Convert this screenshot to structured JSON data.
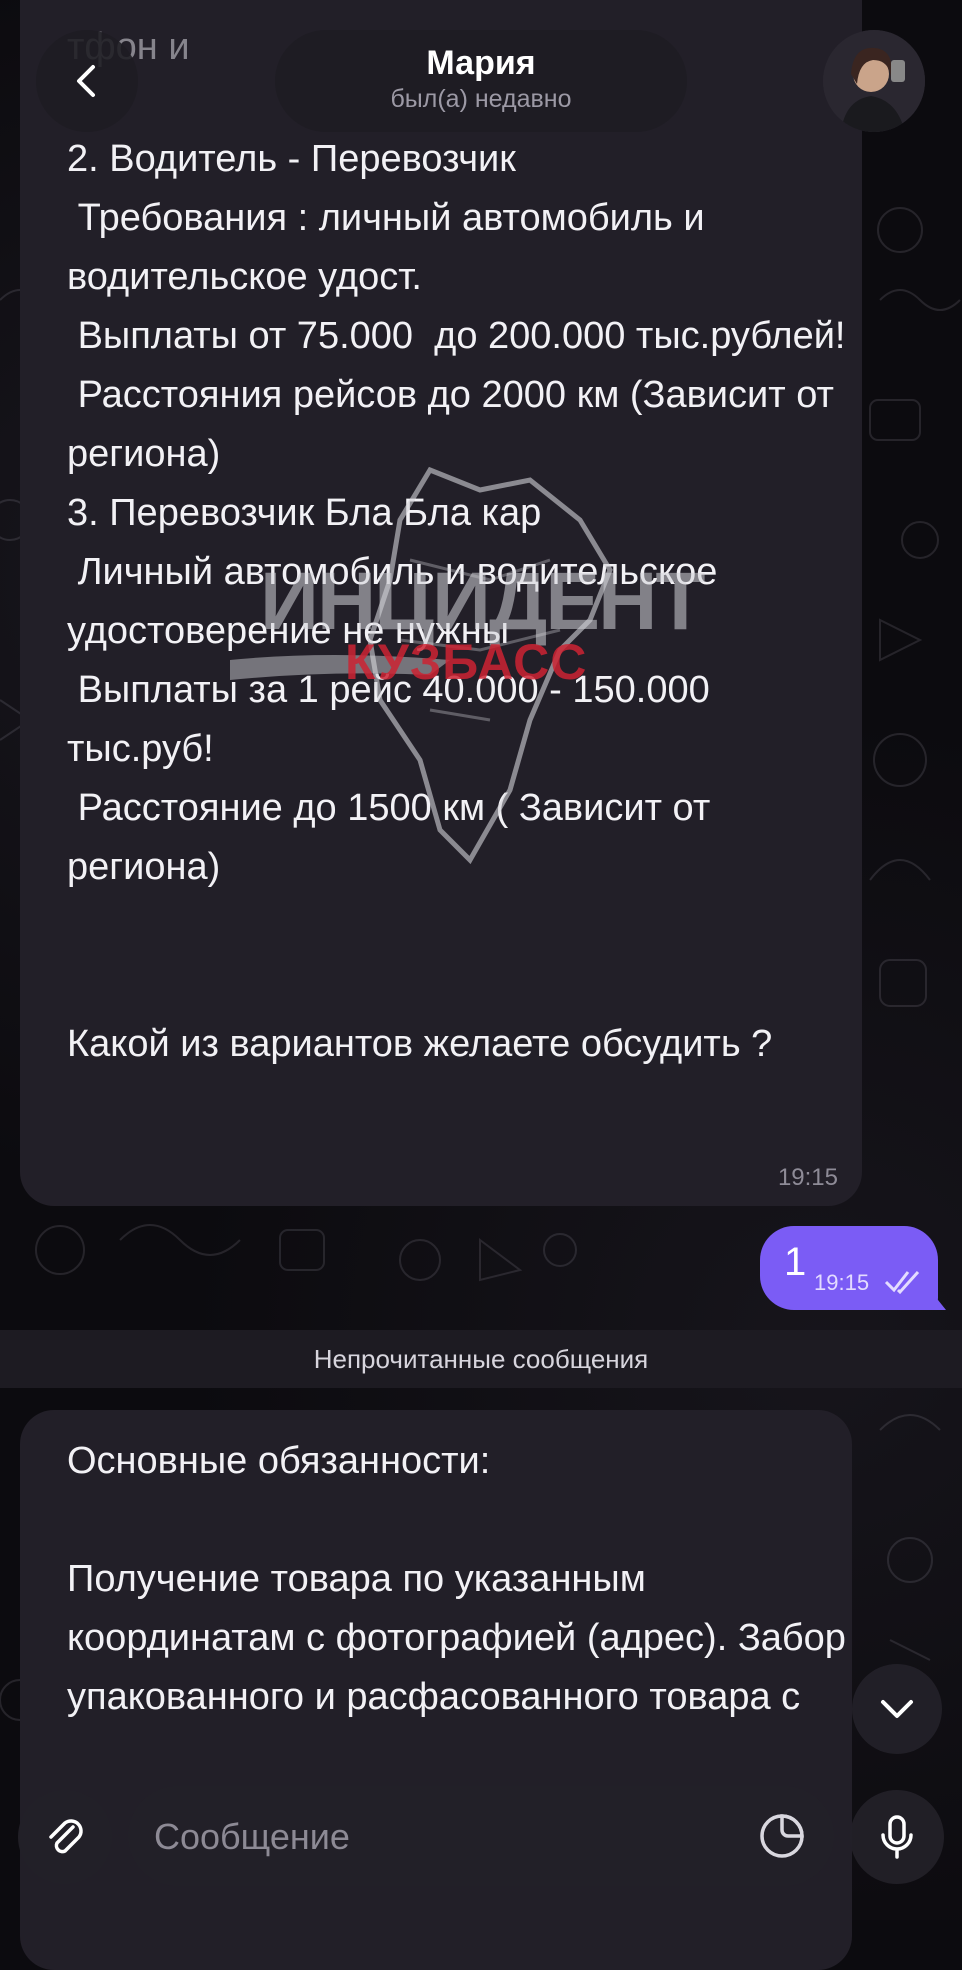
{
  "header": {
    "contact_name": "Мария",
    "status": "был(а) недавно"
  },
  "messages": {
    "first": {
      "partial_top": "тфон и",
      "text": "2. Водитель - Перевозчик\n Требования : личный автомобиль и водительское удост.\n Выплаты от 75.000  до 200.000 тыс.рублей!\n Расстояния рейсов до 2000 км (Зависит от региона)\n3. Перевозчик Бла Бла кар\n Личный автомобиль и водительское удостоверение не нужны\n Выплаты за 1 рейс 40.000 - 150.000 тыс.руб!\n Расстояние до 1500 км ( Зависит от региона)\n\n\nКакой из вариантов желаете обсудить ?",
      "time": "19:15"
    },
    "outgoing": {
      "text": "1",
      "time": "19:15"
    },
    "second": {
      "text": "Основные обязанности:\n\nПолучение товара по указанным координатам с фотографией (адрес). Забор упакованного и расфасованного товара с"
    }
  },
  "unread_label": "Непрочитанные сообщения",
  "watermark": {
    "line1": "ИНЦИДЕНТ",
    "line2": "КУЗБАСС"
  },
  "input": {
    "placeholder": "Сообщение"
  },
  "colors": {
    "outgoing_bubble": "#7b5cf5",
    "incoming_bubble": "#221f28",
    "background": "#0c0b0f",
    "watermark_red": "#cd2332"
  }
}
